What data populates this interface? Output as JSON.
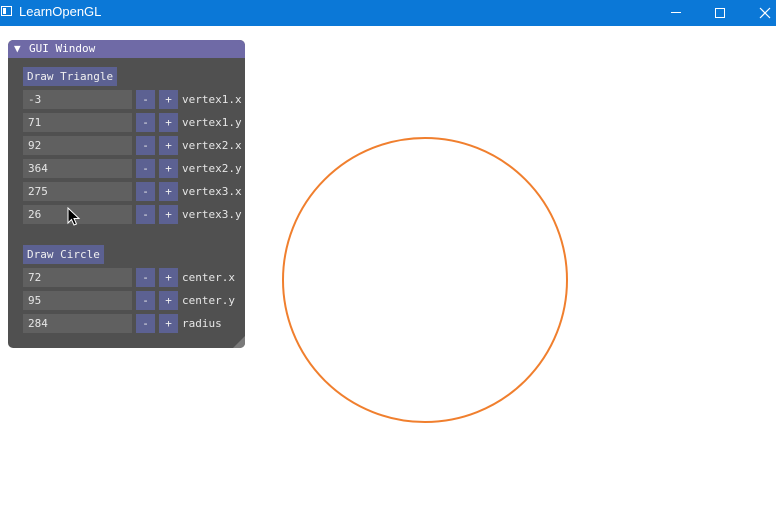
{
  "window": {
    "title": "LearnOpenGL",
    "minimize_icon": "minimize-icon",
    "maximize_icon": "maximize-icon",
    "close_icon": "close-icon"
  },
  "gui": {
    "collapse_glyph": "▼",
    "title": "GUI Window",
    "triangle": {
      "button_label": "Draw Triangle",
      "rows": [
        {
          "value": "-3",
          "minus": "-",
          "plus": "+",
          "label": "vertex1.x"
        },
        {
          "value": "71",
          "minus": "-",
          "plus": "+",
          "label": "vertex1.y"
        },
        {
          "value": "92",
          "minus": "-",
          "plus": "+",
          "label": "vertex2.x"
        },
        {
          "value": "364",
          "minus": "-",
          "plus": "+",
          "label": "vertex2.y"
        },
        {
          "value": "275",
          "minus": "-",
          "plus": "+",
          "label": "vertex3.x"
        },
        {
          "value": "26",
          "minus": "-",
          "plus": "+",
          "label": "vertex3.y"
        }
      ]
    },
    "circle": {
      "button_label": "Draw Circle",
      "rows": [
        {
          "value": "72",
          "minus": "-",
          "plus": "+",
          "label": "center.x"
        },
        {
          "value": "95",
          "minus": "-",
          "plus": "+",
          "label": "center.y"
        },
        {
          "value": "284",
          "minus": "-",
          "plus": "+",
          "label": "radius"
        }
      ]
    }
  },
  "colors": {
    "titlebar": "#0b78d7",
    "gui_background": "#505050",
    "gui_header": "#6f6aa6",
    "button": "#5c6192",
    "field": "#606060",
    "circle_stroke": "#f07f2e"
  }
}
